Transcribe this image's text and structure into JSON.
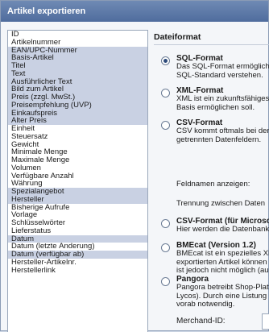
{
  "window": {
    "title": "Artikel exportieren"
  },
  "fields": [
    {
      "label": "ID",
      "selected": false
    },
    {
      "label": "Artikelnummer",
      "selected": false
    },
    {
      "label": "EAN/UPC-Nummer",
      "selected": true
    },
    {
      "label": "Basis-Artikel",
      "selected": true
    },
    {
      "label": "Titel",
      "selected": true
    },
    {
      "label": "Text",
      "selected": true
    },
    {
      "label": "Ausführlicher Text",
      "selected": true
    },
    {
      "label": "Bild zum Artikel",
      "selected": true
    },
    {
      "label": "Preis (zzgl. MwSt.)",
      "selected": true
    },
    {
      "label": "Preisempfehlung (UVP)",
      "selected": true
    },
    {
      "label": "Einkaufspreis",
      "selected": true
    },
    {
      "label": "Alter Preis",
      "selected": true
    },
    {
      "label": "Einheit",
      "selected": false
    },
    {
      "label": "Steuersatz",
      "selected": false
    },
    {
      "label": "Gewicht",
      "selected": false
    },
    {
      "label": "Minimale Menge",
      "selected": false
    },
    {
      "label": "Maximale Menge",
      "selected": false
    },
    {
      "label": "Volumen",
      "selected": false
    },
    {
      "label": "Verfügbare Anzahl",
      "selected": false
    },
    {
      "label": "Währung",
      "selected": false
    },
    {
      "label": "Spezialangebot",
      "selected": true
    },
    {
      "label": "Hersteller",
      "selected": true
    },
    {
      "label": "Bisherige Aufrufe",
      "selected": false
    },
    {
      "label": "Vorlage",
      "selected": false
    },
    {
      "label": "Schlüsselwörter",
      "selected": false
    },
    {
      "label": "Lieferstatus",
      "selected": false
    },
    {
      "label": "Datum",
      "selected": true
    },
    {
      "label": "Datum (letzte Änderung)",
      "selected": false
    },
    {
      "label": "Datum (verfügbar ab)",
      "selected": true
    },
    {
      "label": "Hersteller-Artikelnr.",
      "selected": false
    },
    {
      "label": "Herstellerlink",
      "selected": false
    }
  ],
  "dateiformat": {
    "title": "Dateiformat",
    "options": [
      {
        "title": "SQL-Format",
        "desc": [
          "Das SQL-Format ermöglicht",
          "SQL-Standard verstehen."
        ],
        "checked": true
      },
      {
        "title": "XML-Format",
        "desc": [
          "XML ist ein zukunftsfähiges",
          "Basis ermöglichen soll."
        ],
        "checked": false
      },
      {
        "title": "CSV-Format",
        "desc": [
          "CSV kommt oftmals bei der",
          "getrennten Datenfeldern."
        ],
        "checked": false
      },
      {
        "title": "CSV-Format (für Microsoft",
        "desc": [
          "Hier werden die Datenbank"
        ],
        "checked": false
      },
      {
        "title": "BMEcat (Version 1.2)",
        "desc": [
          "BMEcat ist ein spezielles XML",
          "exportierten Artikel können",
          "ist jedoch nicht möglich (au"
        ],
        "checked": false
      },
      {
        "title": "Pangora",
        "desc": [
          "Pangora betreibt Shop-Platt",
          "Lycos). Durch eine Listung",
          "vorab notwendig."
        ],
        "checked": false
      }
    ],
    "felder_label": "Feldnamen anzeigen:",
    "trennung_label": "Trennung zwischen Daten",
    "merchant_label": "Merchand-ID:"
  }
}
